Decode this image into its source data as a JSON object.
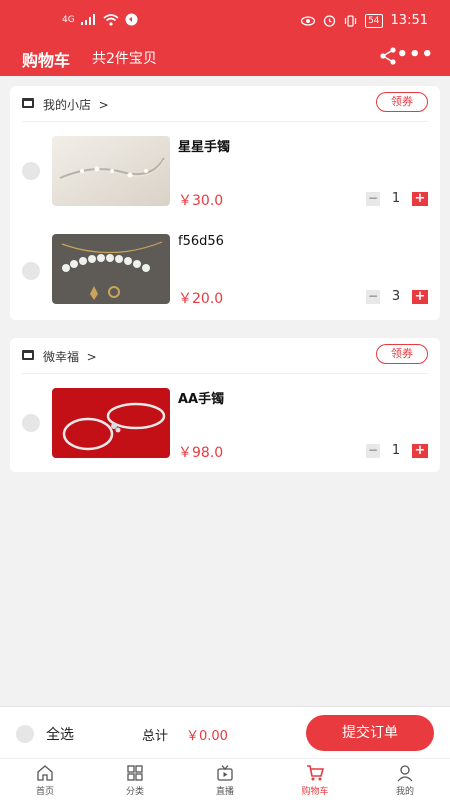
{
  "status_bar": {
    "signal": "4G",
    "battery": "54",
    "time": "13:51"
  },
  "header": {
    "title": "购物车",
    "item_count": "共2件宝贝",
    "more": "•••"
  },
  "stores": [
    {
      "name": "我的小店",
      "chevron": ">",
      "coupon": "领券",
      "items": [
        {
          "name": "星星手镯",
          "price": "￥30.0",
          "quantity": "1"
        },
        {
          "name": "f56d56",
          "price": "￥20.0",
          "quantity": "3"
        }
      ]
    },
    {
      "name": "微幸福",
      "chevron": ">",
      "coupon": "领券",
      "items": [
        {
          "name": "AA手镯",
          "price": "￥98.0",
          "quantity": "1"
        }
      ]
    }
  ],
  "stepper": {
    "minus": "−",
    "plus": "+"
  },
  "bottom_bar": {
    "select_all": "全选",
    "total_label": "总计",
    "total_value": "￥0.00",
    "submit": "提交订单"
  },
  "tabs": [
    {
      "label": "首页",
      "icon": "home-icon",
      "active": false
    },
    {
      "label": "分类",
      "icon": "grid-icon",
      "active": false
    },
    {
      "label": "直播",
      "icon": "live-tv-icon",
      "active": false
    },
    {
      "label": "购物车",
      "icon": "cart-icon",
      "active": true
    },
    {
      "label": "我的",
      "icon": "user-icon",
      "active": false
    }
  ],
  "colors": {
    "brand": "#e83a3f",
    "background": "#f2f2f2"
  }
}
